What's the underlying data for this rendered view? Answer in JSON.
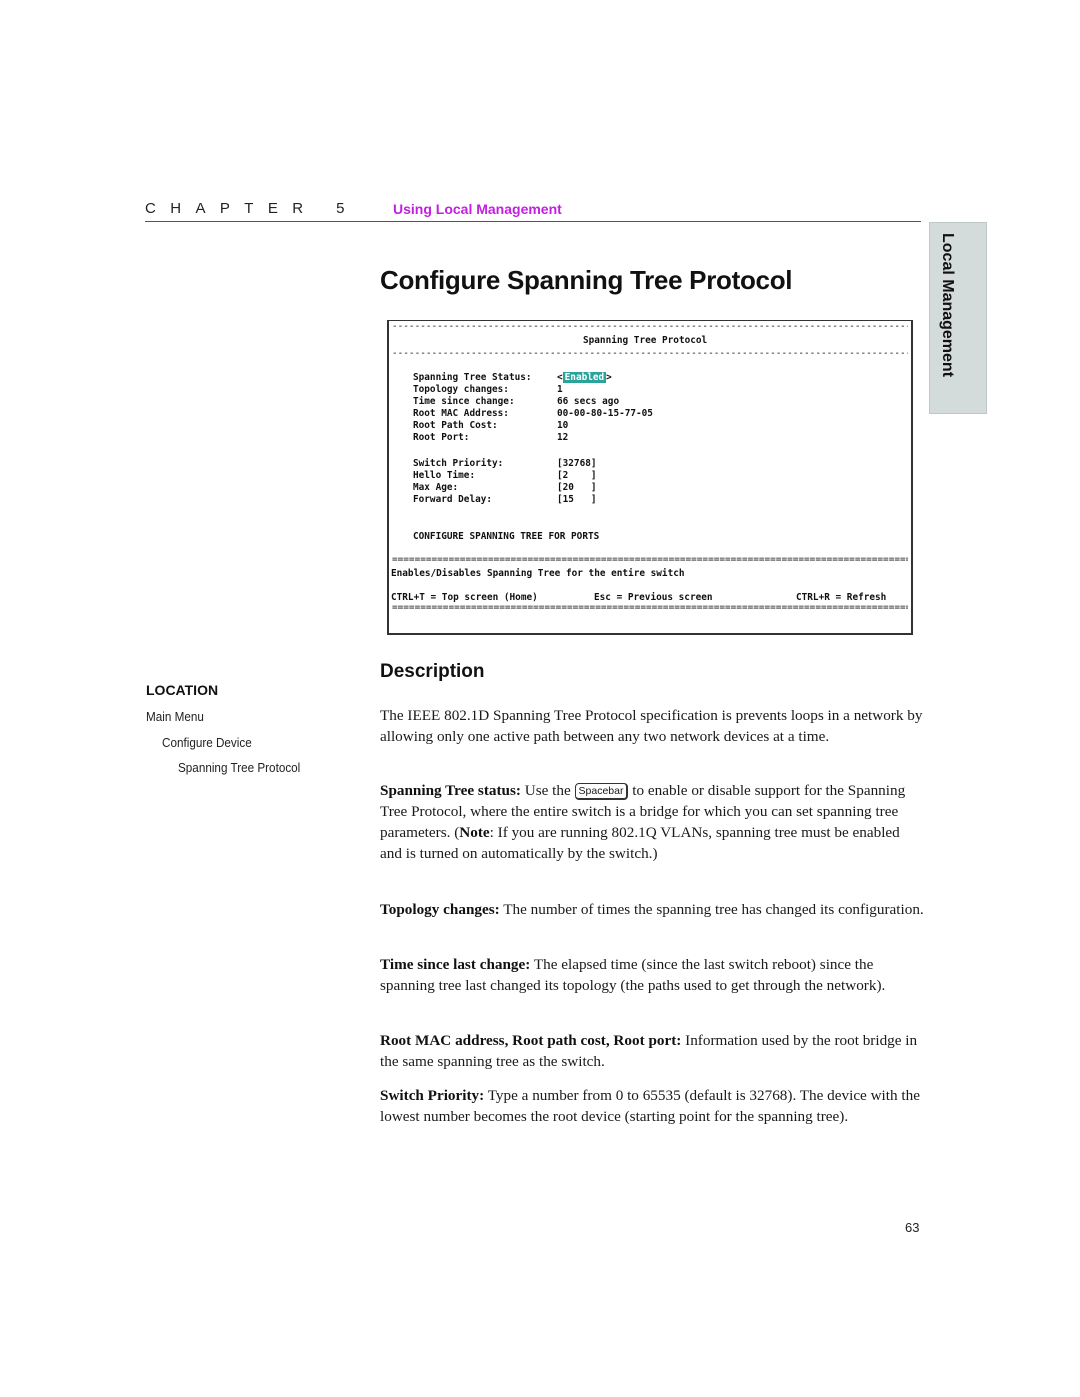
{
  "header": {
    "chapter_word": "CHAPTER",
    "chapter_number": "5",
    "chapter_title": "Using Local Management"
  },
  "side_tab": {
    "label": "Local Management"
  },
  "page_title": "Configure Spanning Tree Protocol",
  "terminal": {
    "dash_rule": "-----------------------------------------------------------------------------------------------------",
    "eq_rule": "=====================================================================================================",
    "screen_title": "Spanning Tree Protocol",
    "fields": [
      {
        "label": "Spanning Tree Status:",
        "value": "Enabled"
      },
      {
        "label": "Topology changes:",
        "value": "1"
      },
      {
        "label": "Time since change:",
        "value": "66 secs ago"
      },
      {
        "label": "Root MAC Address:",
        "value": "00-00-80-15-77-05"
      },
      {
        "label": "Root Path Cost:",
        "value": "10"
      },
      {
        "label": "Root Port:",
        "value": "12"
      }
    ],
    "status_open": "<",
    "status_close": ">",
    "editable_fields": [
      {
        "label": "Switch Priority:",
        "value": "[32768]"
      },
      {
        "label": "Hello Time:",
        "value": "[2    ]"
      },
      {
        "label": "Max Age:",
        "value": "[20   ]"
      },
      {
        "label": "Forward Delay:",
        "value": "[15   ]"
      }
    ],
    "ports_link": "CONFIGURE SPANNING TREE FOR PORTS",
    "help_text": "Enables/Disables Spanning Tree for the entire switch",
    "shortcuts": {
      "home": "CTRL+T = Top screen (Home)",
      "previous": "Esc = Previous screen",
      "refresh": "CTRL+R = Refresh"
    }
  },
  "location": {
    "heading": "LOCATION",
    "path": [
      "Main Menu",
      "Configure Device",
      "Spanning Tree Protocol"
    ]
  },
  "description": {
    "heading": "Description",
    "intro": "The IEEE 802.1D Spanning Tree Protocol specification is prevents loops in a network by allowing only one active path between any two network devices at a time.",
    "status": {
      "term": "Spanning Tree status:",
      "text_before_key": " Use the ",
      "key": "Spacebar",
      "text_after_key": " to enable or disable support for the Spanning Tree Protocol, where the entire switch is a bridge for which you can set spanning tree parameters. (",
      "note_term": "Note",
      "note_text": ": If you are running 802.1Q VLANs, spanning tree must be enabled and is turned on automatically by the switch.)"
    },
    "items": [
      {
        "term": "Topology changes:",
        "text": " The number of times the spanning tree has changed its configuration."
      },
      {
        "term": "Time since last change:",
        "text": " The elapsed time (since the last switch reboot) since the spanning tree last changed its topology (the paths used to get through the network)."
      },
      {
        "term": "Root MAC address, Root path cost, Root port:",
        "text": " Information used by the root bridge in the same spanning tree as the switch."
      },
      {
        "term": "Switch Priority:",
        "text": " Type a number from 0 to 65535 (default is 32768). The device with the lowest number becomes the root device (starting point for the spanning tree)."
      }
    ]
  },
  "page_number": "63",
  "colors": {
    "chapter_accent": "#c21fe0",
    "enabled_highlight": "#2aa39a",
    "side_tab_bg": "#d3dcda"
  }
}
